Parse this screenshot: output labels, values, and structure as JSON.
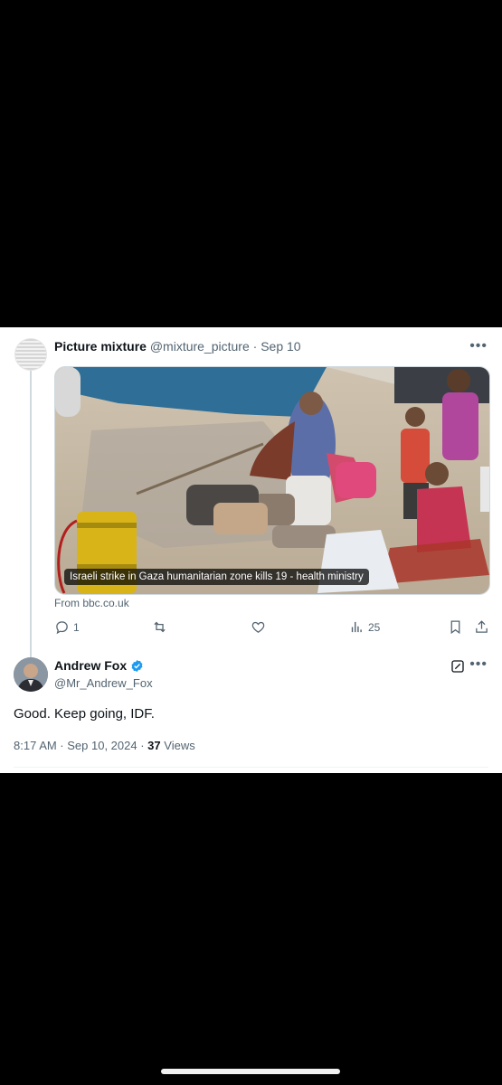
{
  "quoted_tweet": {
    "display_name": "Picture mixture",
    "handle": "@mixture_picture",
    "date": "· Sep 10",
    "media_caption": "Israeli strike in Gaza humanitarian zone kills 19 - health ministry",
    "source": "From bbc.co.uk",
    "actions": {
      "reply_count": "1",
      "views_count": "25"
    }
  },
  "main_tweet": {
    "display_name": "Andrew Fox",
    "handle": "@Mr_Andrew_Fox",
    "text": "Good. Keep going, IDF.",
    "timestamp": "8:17 AM · Sep 10, 2024 ·",
    "views_count": "37",
    "views_label": "Views"
  },
  "icons": [
    "more-icon",
    "reply-icon",
    "retweet-icon",
    "like-icon",
    "views-icon",
    "bookmark-icon",
    "share-icon",
    "verified-icon",
    "grok-icon"
  ],
  "colors": {
    "accent": "#1d9bf0",
    "muted": "#536471",
    "text": "#0f1419",
    "background": "#000000"
  }
}
